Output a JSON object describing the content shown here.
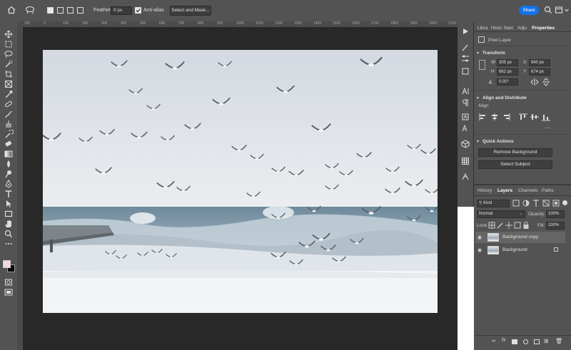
{
  "options_bar": {
    "feather_label": "Feather:",
    "feather_value": "0 px",
    "anti_alias_label": "Anti-alias",
    "select_mask_label": "Select and Mask...",
    "share_label": "Share"
  },
  "ruler": {
    "top_ticks": [
      "100",
      "0",
      "100",
      "200",
      "300",
      "400",
      "500",
      "600",
      "700",
      "800",
      "900",
      "1000",
      "1100",
      "1200",
      "1300",
      "1400",
      "1500",
      "1600",
      "1700",
      "1800",
      "1900",
      "2000",
      "2100"
    ]
  },
  "panel": {
    "tabs": [
      "Libra",
      "Histo",
      "Navi",
      "Adju",
      "Properties"
    ],
    "layer_type": "Pixel Layer",
    "transform": {
      "title": "Transform",
      "w_label": "W",
      "w_value": "305 px",
      "x_label": "X",
      "x_value": "940 px",
      "h_label": "H",
      "h_value": "662 px",
      "y_label": "Y",
      "y_value": "674 px",
      "angle_value": "0,00°"
    },
    "align": {
      "title": "Align and Distribute",
      "sub": "Align"
    },
    "quick_actions": {
      "title": "Quick Actions",
      "remove_bg": "Remove Background",
      "select_subject": "Select Subject"
    }
  },
  "layers_panel": {
    "tabs": [
      "History",
      "Layers",
      "Channels",
      "Paths"
    ],
    "kind_label": "Kind",
    "blend_mode": "Normal",
    "opacity_label": "Opacity:",
    "opacity_value": "100%",
    "lock_label": "Lock:",
    "fill_label": "Fill:",
    "fill_value": "100%",
    "layers": [
      {
        "name": "Background copy"
      },
      {
        "name": "Background"
      }
    ]
  }
}
